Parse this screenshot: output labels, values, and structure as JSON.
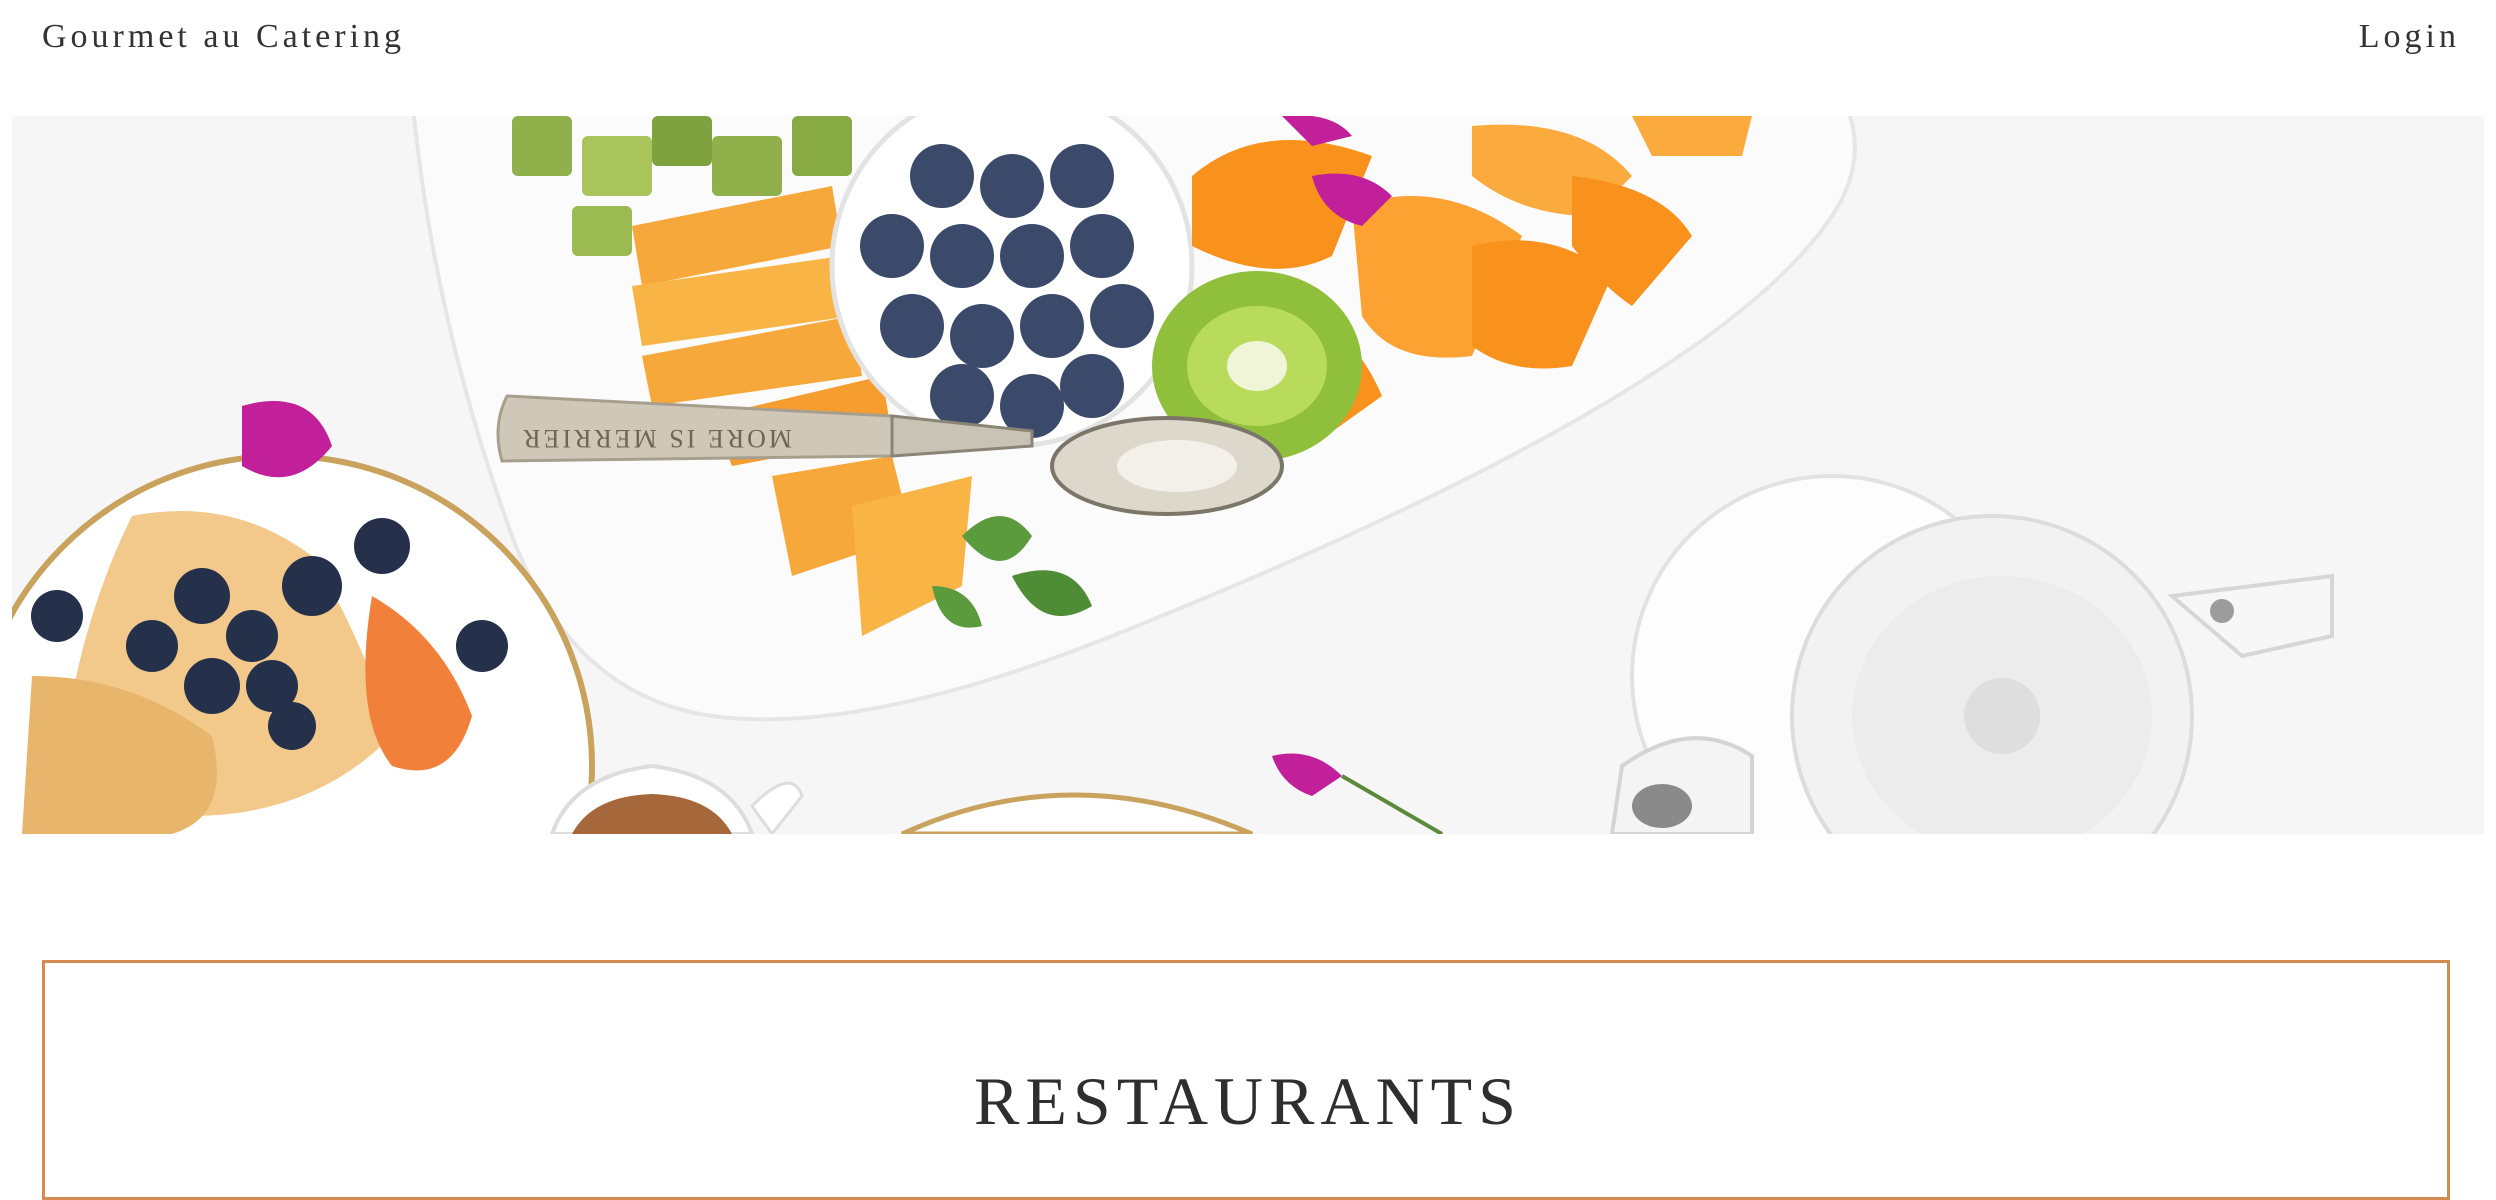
{
  "header": {
    "brand": "Gourmet au Catering",
    "login_label": "Login"
  },
  "hero": {
    "spoon_engraving": "MORE IS MERRIER"
  },
  "section": {
    "title": "RESTAURANTS"
  },
  "colors": {
    "accent_border": "#d58a4f",
    "text": "#2f2f2f",
    "background": "#ffffff"
  }
}
